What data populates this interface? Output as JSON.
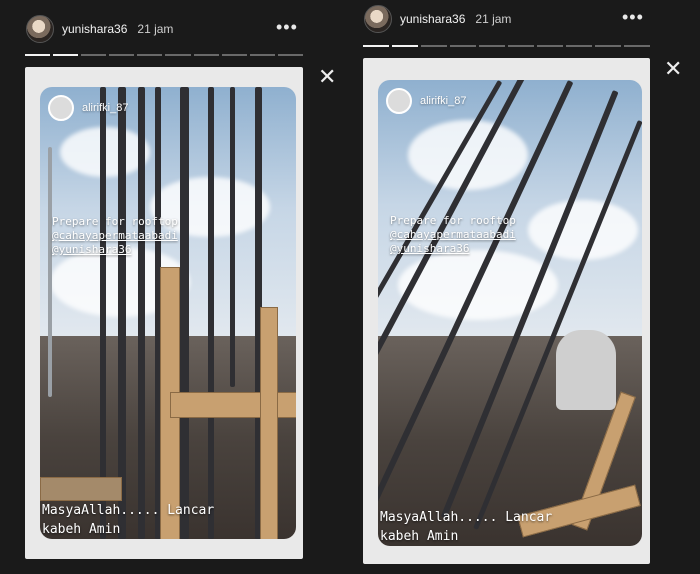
{
  "stories": [
    {
      "username": "yunishara36",
      "time_ago": "21 jam",
      "segments_total": 10,
      "segments_done": 2,
      "post_username": "alirifki_87",
      "text_lines": [
        "Prepare for rooftop",
        "@cahayapermataabadi",
        "@yunishara36"
      ],
      "caption_lines": [
        "MasyaAllah..... Lancar",
        "kabeh Amin"
      ]
    },
    {
      "username": "yunishara36",
      "time_ago": "21 jam",
      "segments_total": 10,
      "segments_done": 2,
      "post_username": "alirifki_87",
      "text_lines": [
        "Prepare for rooftop",
        "@cahayapermataabadi",
        "@yunishara36"
      ],
      "caption_lines": [
        "MasyaAllah..... Lancar",
        "kabeh Amin"
      ]
    }
  ],
  "icons": {
    "more": "more-options-icon",
    "close": "close-icon"
  }
}
